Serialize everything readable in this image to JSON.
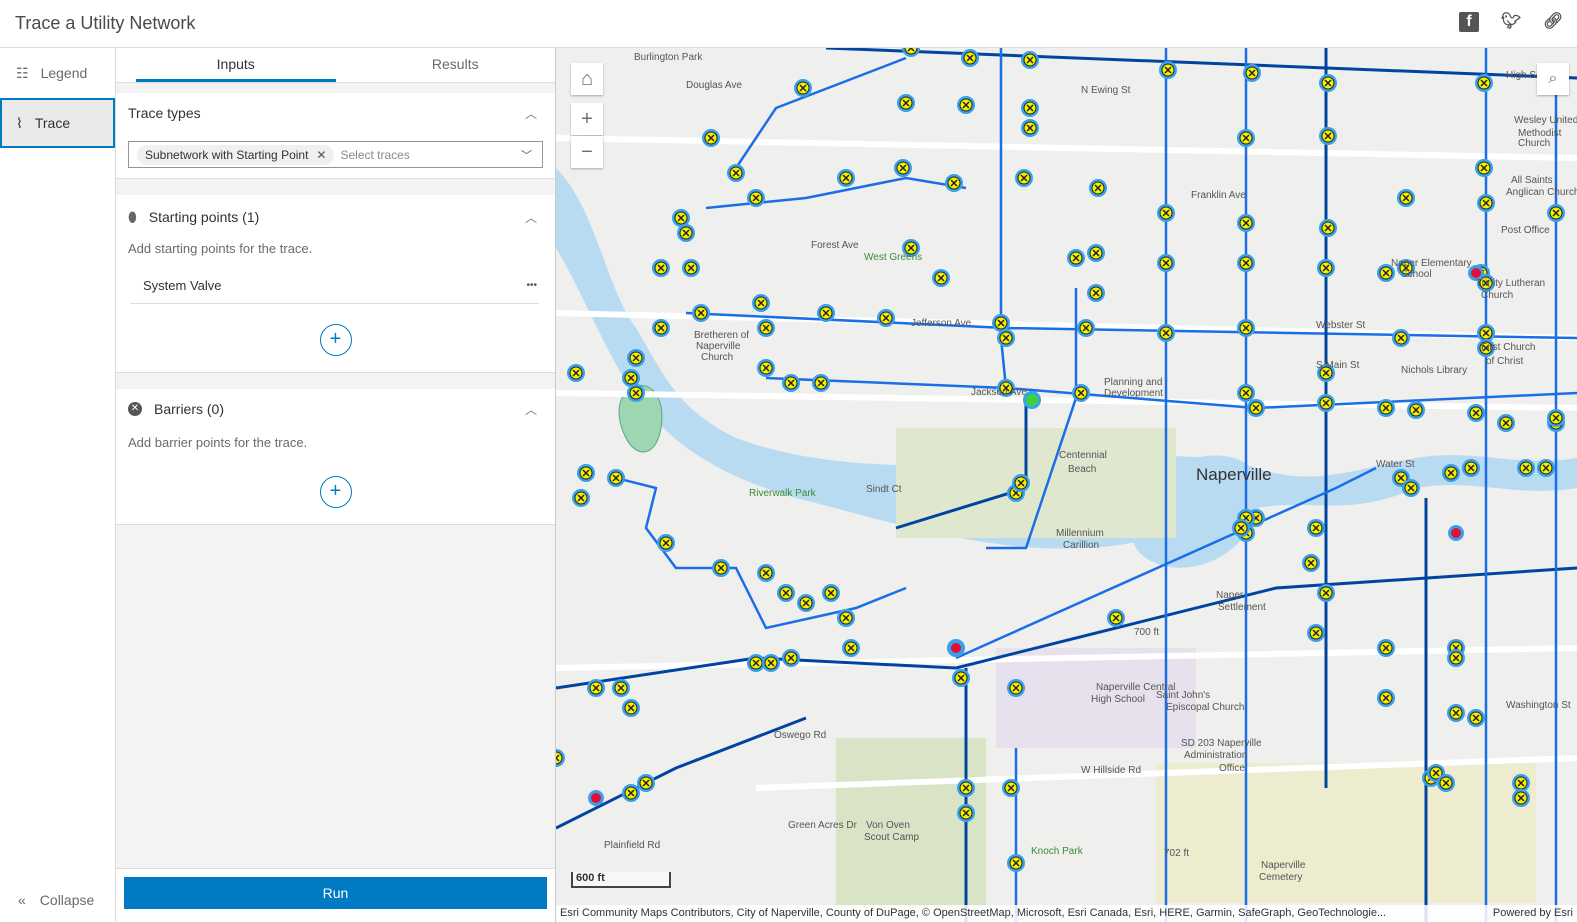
{
  "header": {
    "title": "Trace a Utility Network",
    "icons": [
      "facebook-icon",
      "twitter-icon",
      "link-icon"
    ]
  },
  "rail": {
    "items": [
      {
        "label": "Legend",
        "icon": "legend-icon"
      },
      {
        "label": "Trace",
        "icon": "trace-icon"
      }
    ],
    "collapse": "Collapse"
  },
  "panel": {
    "tabs": [
      "Inputs",
      "Results"
    ],
    "trace_types": {
      "title": "Trace types",
      "chip": "Subnetwork with Starting Point",
      "placeholder": "Select traces"
    },
    "starting_points": {
      "title": "Starting points (1)",
      "desc": "Add starting points for the trace.",
      "items": [
        "System Valve"
      ],
      "more": "•••"
    },
    "barriers": {
      "title": "Barriers (0)",
      "desc": "Add barrier points for the trace."
    },
    "run": "Run"
  },
  "map": {
    "scale": "600 ft",
    "attribution": "Esri Community Maps Contributors, City of Naperville, County of DuPage, © OpenStreetMap, Microsoft, Esri Canada, Esri, HERE, Garmin, SafeGraph, GeoTechnologie...",
    "powered": "Powered by Esri",
    "labels": [
      "Burlington Park",
      "Douglas Ave",
      "N Ewing St",
      "High School",
      "Wesley United",
      "Methodist",
      "Church",
      "Franklin Ave",
      "All Saints",
      "Anglican Church",
      "Post Office",
      "Forest Ave",
      "West Greens",
      "Naper Elementary",
      "School",
      "Trinity Lutheran",
      "Church",
      "Bretheren of",
      "Naperville",
      "Church",
      "Jefferson Ave",
      "Nichols Library",
      "First Church",
      "of Christ",
      "Planning and",
      "Development",
      "Jackson Ave",
      "Centennial",
      "Beach",
      "Naperville",
      "Water St",
      "Riverwalk Park",
      "Sindt Ct",
      "Millennium",
      "Carillion",
      "Naper",
      "Settlement",
      "700 ft",
      "Saint John's",
      "Episcopal Church",
      "Naperville Central",
      "High School",
      "SD 203 Naperville",
      "Administration",
      "Office",
      "Oswego Rd",
      "W Hillside Rd",
      "Von Oven",
      "Scout Camp",
      "Knoch Park",
      "702 ft",
      "Naperville",
      "Cemetery",
      "Green Acres Dr",
      "Plainfield Rd",
      "Webster St",
      "S Main St",
      "Washington St"
    ]
  }
}
